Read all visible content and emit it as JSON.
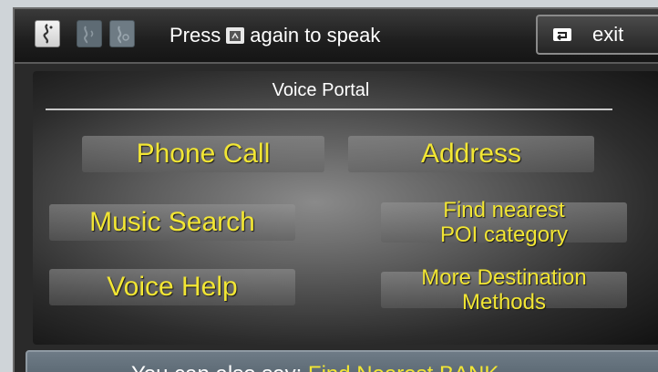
{
  "header": {
    "mode_icons": [
      {
        "name": "voice-active-icon",
        "state": "active"
      },
      {
        "name": "voice-listening-icon",
        "state": "inactive"
      },
      {
        "name": "voice-processing-icon",
        "state": "inactive"
      }
    ],
    "prompt_before": "Press",
    "prompt_icon": "talk-button-icon",
    "prompt_after": "again to speak",
    "exit_label": "exit",
    "exit_icon": "back-arrow-icon"
  },
  "portal": {
    "title": "Voice Portal",
    "options": {
      "phone_call": "Phone Call",
      "address": "Address",
      "music_search": "Music Search",
      "find_poi_line1": "Find nearest",
      "find_poi_line2": "POI category",
      "voice_help": "Voice Help",
      "more_dest_line1": "More Destination",
      "more_dest_line2": "Methods"
    }
  },
  "footer": {
    "prefix": "You can also say:",
    "command": "Find Nearest BANK"
  },
  "colors": {
    "option_text": "#f2e634",
    "background": "#2a2a2a",
    "footer_bar": "#64717c"
  }
}
